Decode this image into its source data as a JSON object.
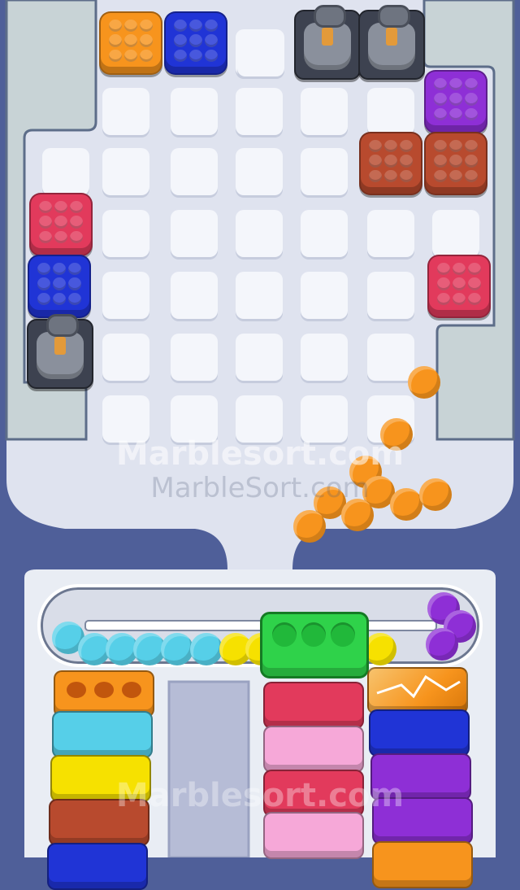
{
  "watermark": {
    "primary": "Marblesort.com",
    "secondary": "MarbleSort.com",
    "lower": "Marblesort.com"
  },
  "colors": {
    "orange": "#f7941d",
    "blue": "#2034d6",
    "purple": "#8e2fd6",
    "brown": "#b84a2e",
    "red": "#e23a5c",
    "cyan": "#56cfe8",
    "yellow": "#f6e100",
    "green": "#2fd24a",
    "pink": "#f6a8d8",
    "gray": "#4a4f5a"
  },
  "board": {
    "blocks": [
      {
        "kind": "color",
        "color": "orange"
      },
      {
        "kind": "color",
        "color": "blue"
      },
      {
        "kind": "sack"
      },
      {
        "kind": "sack"
      },
      {
        "kind": "color",
        "color": "purple"
      },
      {
        "kind": "color",
        "color": "brown"
      },
      {
        "kind": "color",
        "color": "brown"
      },
      {
        "kind": "color",
        "color": "red"
      },
      {
        "kind": "color",
        "color": "red"
      },
      {
        "kind": "color",
        "color": "blue"
      },
      {
        "kind": "sack"
      }
    ],
    "loose_marbles": {
      "color": "orange",
      "count": 12
    }
  },
  "conveyor": {
    "marbles": [
      "cyan",
      "cyan",
      "cyan",
      "cyan",
      "cyan",
      "cyan",
      "yellow",
      "yellow",
      "yellow",
      "purple",
      "purple",
      "purple"
    ],
    "collector": {
      "color": "green",
      "slots": 3
    }
  },
  "stacks": [
    {
      "name": "left",
      "bars": [
        "orange",
        "cyan",
        "yellow",
        "brown",
        "blue"
      ]
    },
    {
      "name": "middle",
      "bars": [
        "red",
        "pink",
        "red",
        "pink"
      ]
    },
    {
      "name": "right",
      "bars": [
        "orange-cracked",
        "blue",
        "purple",
        "purple"
      ]
    }
  ]
}
